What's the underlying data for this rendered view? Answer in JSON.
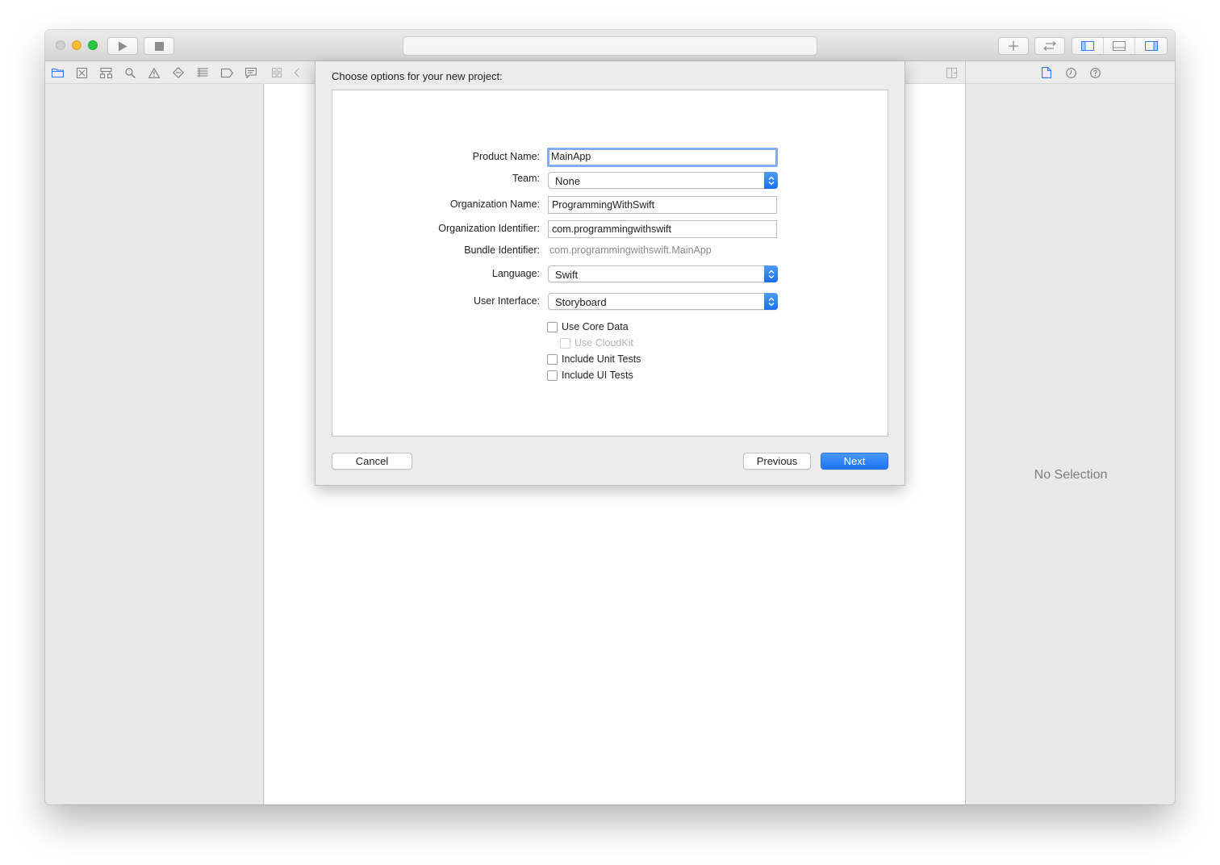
{
  "toolbar": {
    "run_icon": "play-icon",
    "stop_icon": "stop-icon",
    "activity_text": "",
    "library_icon": "plus-icon",
    "review_icon": "swap-arrows-icon",
    "panel_icons": [
      "left-panel-icon",
      "bottom-panel-icon",
      "right-panel-icon"
    ]
  },
  "navigator": {
    "icons": [
      "folder-icon",
      "source-control-icon",
      "hierarchy-icon",
      "search-icon",
      "warning-icon",
      "test-icon",
      "debug-icon",
      "breakpoint-icon",
      "report-icon"
    ]
  },
  "inspector": {
    "icons": [
      "file-icon",
      "history-icon",
      "help-icon"
    ],
    "no_selection": "No Selection"
  },
  "sheet": {
    "title": "Choose options for your new project:",
    "fields": {
      "product_name": {
        "label": "Product Name:",
        "value": "MainApp"
      },
      "team": {
        "label": "Team:",
        "value": "None"
      },
      "organization_name": {
        "label": "Organization Name:",
        "value": "ProgrammingWithSwift"
      },
      "organization_identifier": {
        "label": "Organization Identifier:",
        "value": "com.programmingwithswift"
      },
      "bundle_identifier": {
        "label": "Bundle Identifier:",
        "value": "com.programmingwithswift.MainApp"
      },
      "language": {
        "label": "Language:",
        "value": "Swift"
      },
      "user_interface": {
        "label": "User Interface:",
        "value": "Storyboard"
      }
    },
    "checkboxes": {
      "use_core_data": "Use Core Data",
      "use_cloudkit": "Use CloudKit",
      "include_unit_tests": "Include Unit Tests",
      "include_ui_tests": "Include UI Tests"
    },
    "buttons": {
      "cancel": "Cancel",
      "previous": "Previous",
      "next": "Next"
    }
  },
  "colors": {
    "accent": "#1d73f4",
    "focus_ring": "#80aef2"
  }
}
